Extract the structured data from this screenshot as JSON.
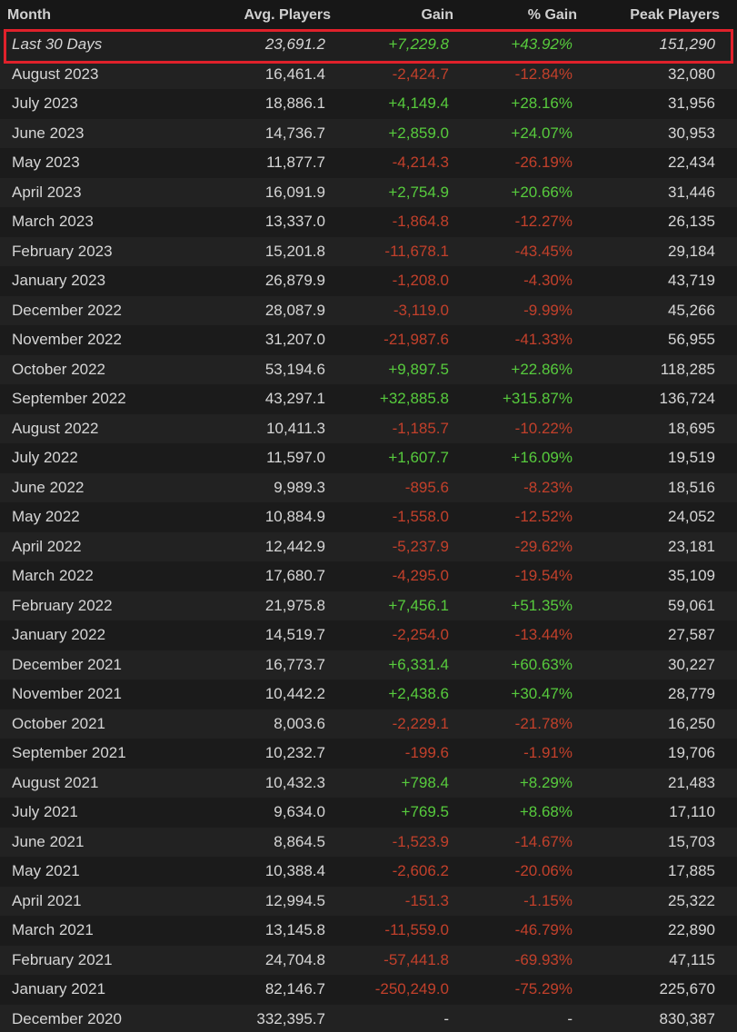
{
  "headers": {
    "month": "Month",
    "avg_players": "Avg. Players",
    "gain": "Gain",
    "pct_gain": "% Gain",
    "peak_players": "Peak Players"
  },
  "summary": {
    "month": "Last 30 Days",
    "avg": "23,691.2",
    "gain": "+7,229.8",
    "pct": "+43.92%",
    "peak": "151,290",
    "trend": "pos"
  },
  "highlight_color": "#e0212b",
  "colors": {
    "positive": "#57cb3d",
    "negative": "#c2402b",
    "background": "#1b1b1b"
  },
  "rows": [
    {
      "month": "August 2023",
      "avg": "16,461.4",
      "gain": "-2,424.7",
      "pct": "-12.84%",
      "peak": "32,080",
      "trend": "neg"
    },
    {
      "month": "July 2023",
      "avg": "18,886.1",
      "gain": "+4,149.4",
      "pct": "+28.16%",
      "peak": "31,956",
      "trend": "pos"
    },
    {
      "month": "June 2023",
      "avg": "14,736.7",
      "gain": "+2,859.0",
      "pct": "+24.07%",
      "peak": "30,953",
      "trend": "pos"
    },
    {
      "month": "May 2023",
      "avg": "11,877.7",
      "gain": "-4,214.3",
      "pct": "-26.19%",
      "peak": "22,434",
      "trend": "neg"
    },
    {
      "month": "April 2023",
      "avg": "16,091.9",
      "gain": "+2,754.9",
      "pct": "+20.66%",
      "peak": "31,446",
      "trend": "pos"
    },
    {
      "month": "March 2023",
      "avg": "13,337.0",
      "gain": "-1,864.8",
      "pct": "-12.27%",
      "peak": "26,135",
      "trend": "neg"
    },
    {
      "month": "February 2023",
      "avg": "15,201.8",
      "gain": "-11,678.1",
      "pct": "-43.45%",
      "peak": "29,184",
      "trend": "neg"
    },
    {
      "month": "January 2023",
      "avg": "26,879.9",
      "gain": "-1,208.0",
      "pct": "-4.30%",
      "peak": "43,719",
      "trend": "neg"
    },
    {
      "month": "December 2022",
      "avg": "28,087.9",
      "gain": "-3,119.0",
      "pct": "-9.99%",
      "peak": "45,266",
      "trend": "neg"
    },
    {
      "month": "November 2022",
      "avg": "31,207.0",
      "gain": "-21,987.6",
      "pct": "-41.33%",
      "peak": "56,955",
      "trend": "neg"
    },
    {
      "month": "October 2022",
      "avg": "53,194.6",
      "gain": "+9,897.5",
      "pct": "+22.86%",
      "peak": "118,285",
      "trend": "pos"
    },
    {
      "month": "September 2022",
      "avg": "43,297.1",
      "gain": "+32,885.8",
      "pct": "+315.87%",
      "peak": "136,724",
      "trend": "pos"
    },
    {
      "month": "August 2022",
      "avg": "10,411.3",
      "gain": "-1,185.7",
      "pct": "-10.22%",
      "peak": "18,695",
      "trend": "neg"
    },
    {
      "month": "July 2022",
      "avg": "11,597.0",
      "gain": "+1,607.7",
      "pct": "+16.09%",
      "peak": "19,519",
      "trend": "pos"
    },
    {
      "month": "June 2022",
      "avg": "9,989.3",
      "gain": "-895.6",
      "pct": "-8.23%",
      "peak": "18,516",
      "trend": "neg"
    },
    {
      "month": "May 2022",
      "avg": "10,884.9",
      "gain": "-1,558.0",
      "pct": "-12.52%",
      "peak": "24,052",
      "trend": "neg"
    },
    {
      "month": "April 2022",
      "avg": "12,442.9",
      "gain": "-5,237.9",
      "pct": "-29.62%",
      "peak": "23,181",
      "trend": "neg"
    },
    {
      "month": "March 2022",
      "avg": "17,680.7",
      "gain": "-4,295.0",
      "pct": "-19.54%",
      "peak": "35,109",
      "trend": "neg"
    },
    {
      "month": "February 2022",
      "avg": "21,975.8",
      "gain": "+7,456.1",
      "pct": "+51.35%",
      "peak": "59,061",
      "trend": "pos"
    },
    {
      "month": "January 2022",
      "avg": "14,519.7",
      "gain": "-2,254.0",
      "pct": "-13.44%",
      "peak": "27,587",
      "trend": "neg"
    },
    {
      "month": "December 2021",
      "avg": "16,773.7",
      "gain": "+6,331.4",
      "pct": "+60.63%",
      "peak": "30,227",
      "trend": "pos"
    },
    {
      "month": "November 2021",
      "avg": "10,442.2",
      "gain": "+2,438.6",
      "pct": "+30.47%",
      "peak": "28,779",
      "trend": "pos"
    },
    {
      "month": "October 2021",
      "avg": "8,003.6",
      "gain": "-2,229.1",
      "pct": "-21.78%",
      "peak": "16,250",
      "trend": "neg"
    },
    {
      "month": "September 2021",
      "avg": "10,232.7",
      "gain": "-199.6",
      "pct": "-1.91%",
      "peak": "19,706",
      "trend": "neg"
    },
    {
      "month": "August 2021",
      "avg": "10,432.3",
      "gain": "+798.4",
      "pct": "+8.29%",
      "peak": "21,483",
      "trend": "pos"
    },
    {
      "month": "July 2021",
      "avg": "9,634.0",
      "gain": "+769.5",
      "pct": "+8.68%",
      "peak": "17,110",
      "trend": "pos"
    },
    {
      "month": "June 2021",
      "avg": "8,864.5",
      "gain": "-1,523.9",
      "pct": "-14.67%",
      "peak": "15,703",
      "trend": "neg"
    },
    {
      "month": "May 2021",
      "avg": "10,388.4",
      "gain": "-2,606.2",
      "pct": "-20.06%",
      "peak": "17,885",
      "trend": "neg"
    },
    {
      "month": "April 2021",
      "avg": "12,994.5",
      "gain": "-151.3",
      "pct": "-1.15%",
      "peak": "25,322",
      "trend": "neg"
    },
    {
      "month": "March 2021",
      "avg": "13,145.8",
      "gain": "-11,559.0",
      "pct": "-46.79%",
      "peak": "22,890",
      "trend": "neg"
    },
    {
      "month": "February 2021",
      "avg": "24,704.8",
      "gain": "-57,441.8",
      "pct": "-69.93%",
      "peak": "47,115",
      "trend": "neg"
    },
    {
      "month": "January 2021",
      "avg": "82,146.7",
      "gain": "-250,249.0",
      "pct": "-75.29%",
      "peak": "225,670",
      "trend": "neg"
    },
    {
      "month": "December 2020",
      "avg": "332,395.7",
      "gain": "-",
      "pct": "-",
      "peak": "830,387",
      "trend": "neutral"
    }
  ]
}
